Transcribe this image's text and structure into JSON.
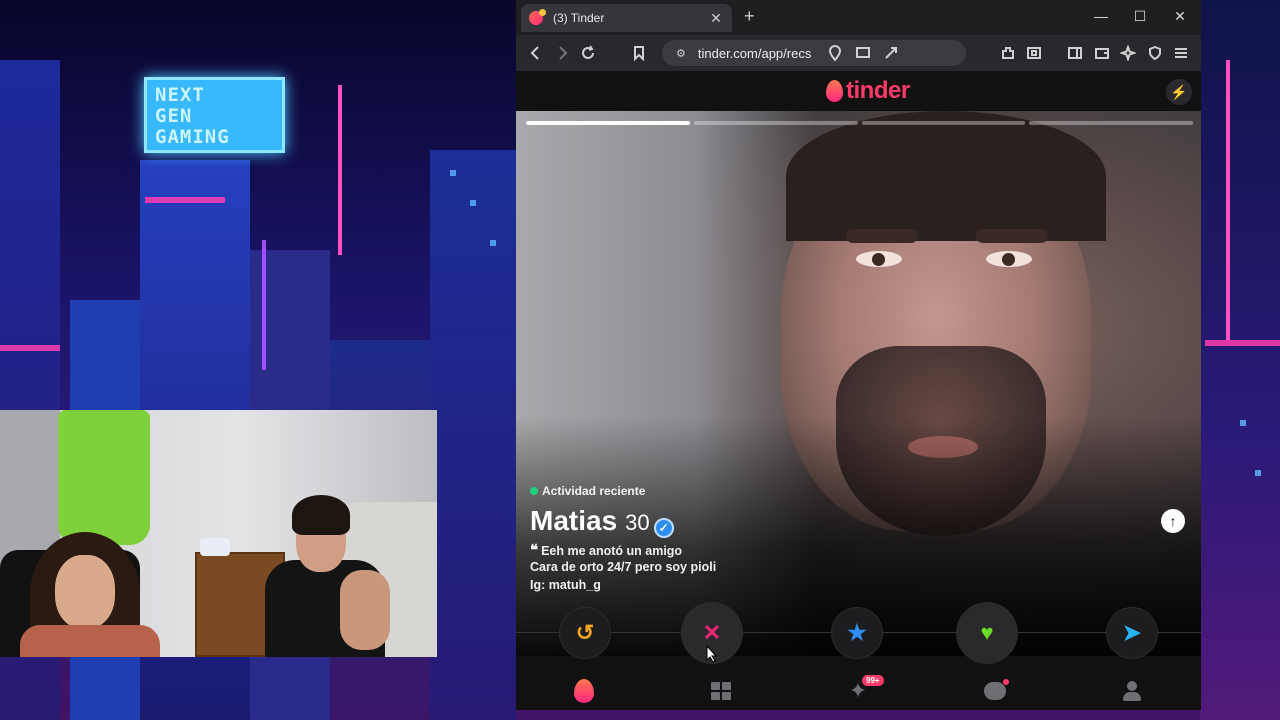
{
  "wallpaper": {
    "sign_lines": [
      "NEXT",
      "GEN",
      "GAMING"
    ]
  },
  "browser": {
    "tab_title": "(3) Tinder",
    "tab_close": "✕",
    "new_tab": "+",
    "window_controls": [
      "—",
      "☐",
      "✕"
    ],
    "url": "tinder.com/app/recs",
    "brave_shield_count": "3",
    "colors": {
      "titlebar": "#1f1f22",
      "toolbar": "#28292c",
      "urlbar": "#3a3b3f"
    }
  },
  "tinder": {
    "logo_text": "tinder",
    "brand_color": "#fd3a6a",
    "profile": {
      "photo_count": 4,
      "active_photo": 1,
      "activity": "Actividad reciente",
      "name": "Matias",
      "age": "30",
      "verified": true,
      "bio": [
        "Eeh me anotó un amigo",
        "Cara de orto 24/7 pero soy pioli",
        "Ig: matuh_g"
      ]
    },
    "actions": [
      {
        "name": "rewind",
        "icon": "rewind-icon",
        "glyph": "↺",
        "color": "#f5a623"
      },
      {
        "name": "nope",
        "icon": "close-icon",
        "glyph": "✕",
        "color": "#fd267d"
      },
      {
        "name": "super-like",
        "icon": "star-icon",
        "glyph": "★",
        "color": "#2f8cf0"
      },
      {
        "name": "like",
        "icon": "heart-icon",
        "glyph": "♥",
        "color": "#6bdb29"
      },
      {
        "name": "boost",
        "icon": "send-icon",
        "glyph": "➤",
        "color": "#2ab3f2"
      }
    ],
    "nav": {
      "likes_badge": "99+"
    }
  }
}
